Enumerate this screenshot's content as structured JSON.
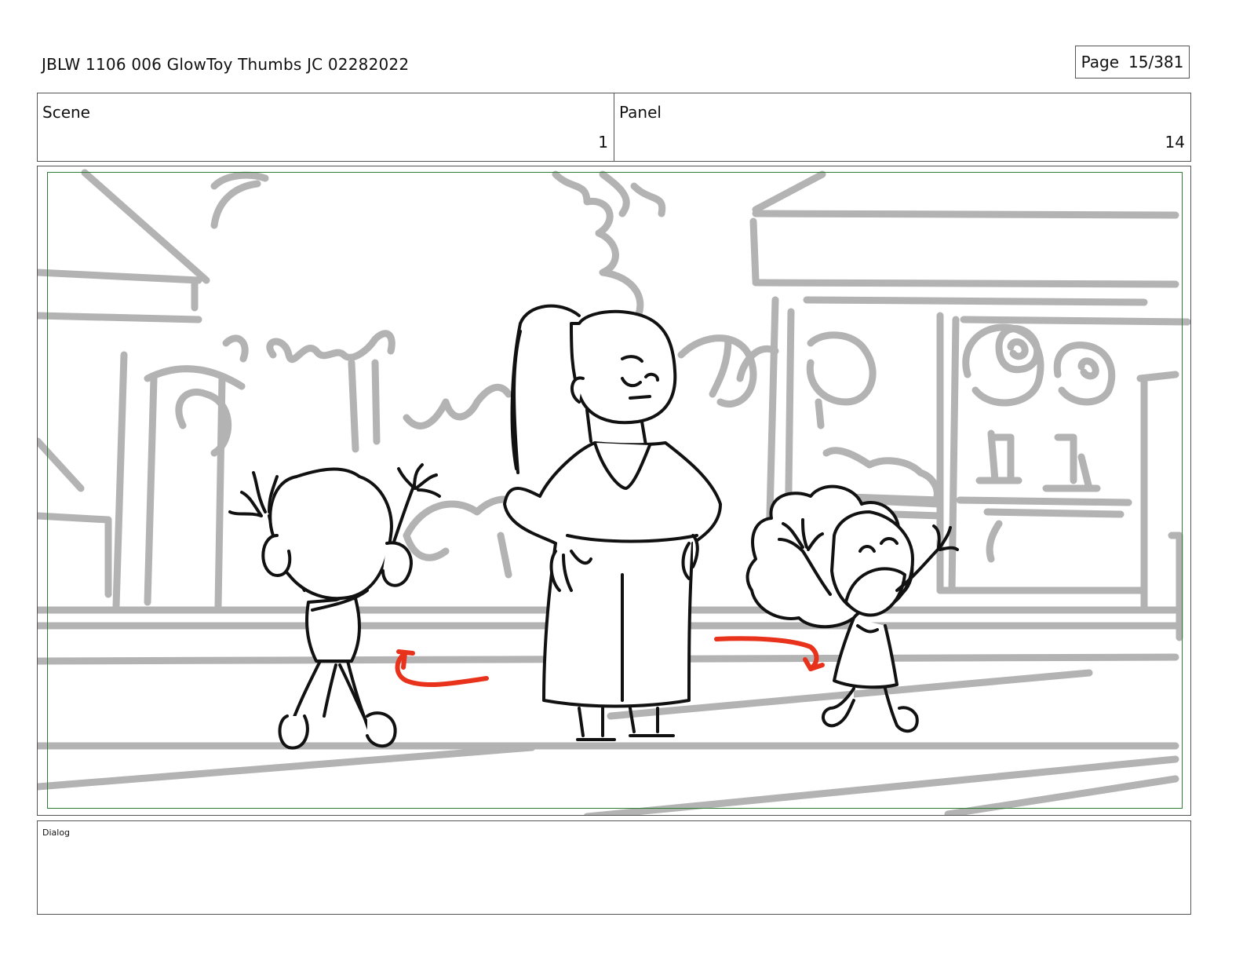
{
  "header": {
    "title": "JBLW 1106 006 GlowToy Thumbs JC 02282022",
    "page_label": "Page",
    "page_value": "15/381"
  },
  "info": {
    "scene_label": "Scene",
    "scene_value": "1",
    "panel_label": "Panel",
    "panel_value": "14"
  },
  "dialog": {
    "label": "Dialog",
    "text": ""
  },
  "colors": {
    "background_sketch": "#b3b3b3",
    "character_line": "#111111",
    "motion_arrow": "#e8321b",
    "safe_frame": "#2e7d32"
  }
}
